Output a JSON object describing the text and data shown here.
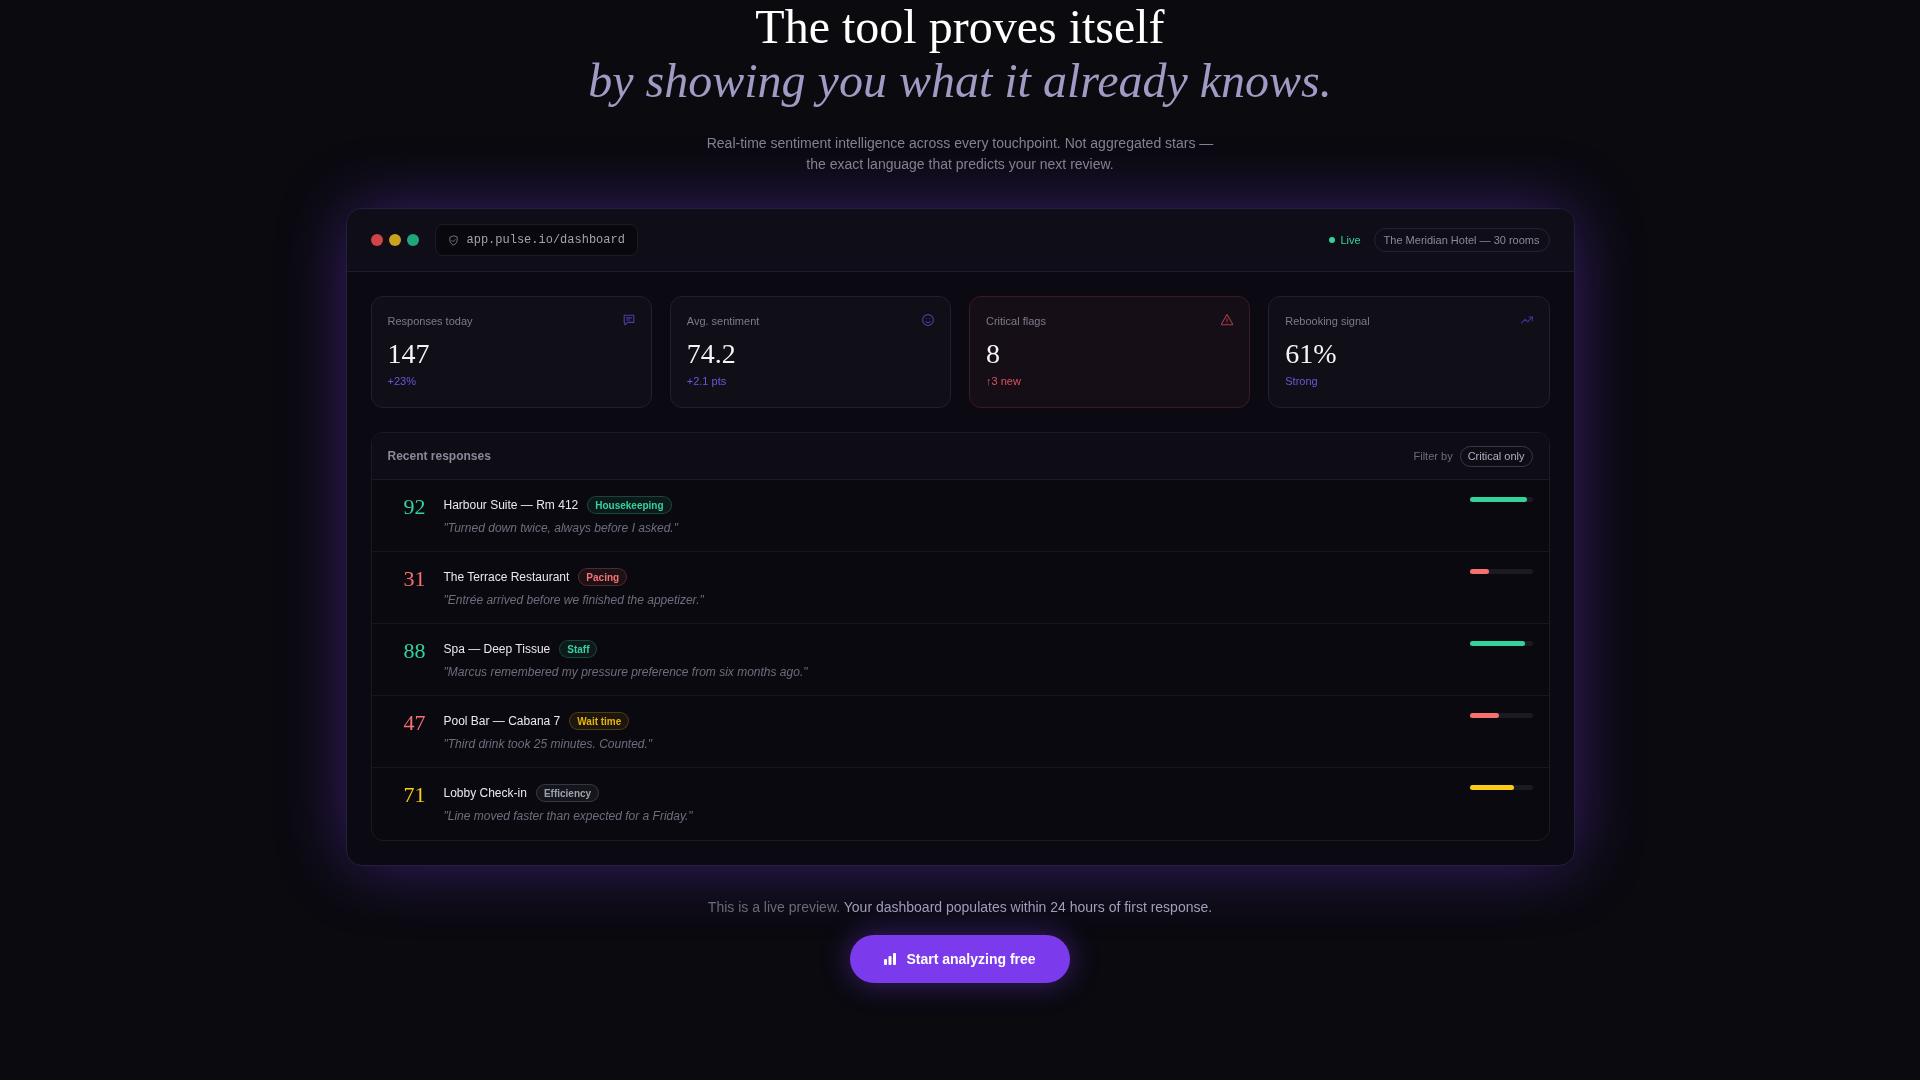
{
  "hero": {
    "title": "The tool proves itself",
    "subtitle": "by showing you what it already knows.",
    "description": "Real-time sentiment intelligence across every touchpoint. Not aggregated stars — the exact language that predicts your next review."
  },
  "window": {
    "url": "app.pulse.io/dashboard",
    "status": "Live",
    "property": "The Meridian Hotel — 30 rooms"
  },
  "stats": [
    {
      "kind": "normal",
      "label": "Responses today",
      "value": "147",
      "change": "+23%"
    },
    {
      "kind": "normal",
      "label": "Avg. sentiment",
      "value": "74.2",
      "change": "+2.1 pts"
    },
    {
      "kind": "critical",
      "label": "Critical flags",
      "value": "8",
      "change": "↑3 new"
    },
    {
      "kind": "normal",
      "label": "Rebooking signal",
      "value": "61%",
      "change": "Strong"
    }
  ],
  "recent": {
    "title": "Recent responses",
    "filter_label": "Filter by",
    "filter": "Critical only",
    "rows": [
      {
        "score": "92",
        "color": "#34d399",
        "name": "Harbour Suite — Rm 412",
        "tag": {
          "label": "Housekeeping",
          "color": "#34d399"
        },
        "quote": "\"Turned down twice, always before I asked.\"",
        "level": 0.92
      },
      {
        "score": "31",
        "color": "#f87171",
        "name": "The Terrace Restaurant",
        "tag": {
          "label": "Pacing",
          "color": "#f87171"
        },
        "quote": "\"Entrée arrived before we finished the appetizer.\"",
        "level": 0.31
      },
      {
        "score": "88",
        "color": "#34d399",
        "name": "Spa — Deep Tissue",
        "tag": {
          "label": "Staff",
          "color": "#34d399"
        },
        "quote": "\"Marcus remembered my pressure preference from six months ago.\"",
        "level": 0.88
      },
      {
        "score": "47",
        "color": "#f87171",
        "name": "Pool Bar — Cabana 7",
        "tag": {
          "label": "Wait time",
          "color": "#eab308"
        },
        "quote": "\"Third drink took 25 minutes. Counted.\"",
        "level": 0.47
      },
      {
        "score": "71",
        "color": "#facc15",
        "name": "Lobby Check-in",
        "tag": {
          "label": "Efficiency",
          "color": "#9ca3af"
        },
        "quote": "\"Line moved faster than expected for a Friday.\"",
        "level": 0.71
      }
    ]
  },
  "footer": {
    "note": "This is a live preview.",
    "detail": "Your dashboard populates within 24 hours of first response.",
    "cta": "Start analyzing free"
  }
}
